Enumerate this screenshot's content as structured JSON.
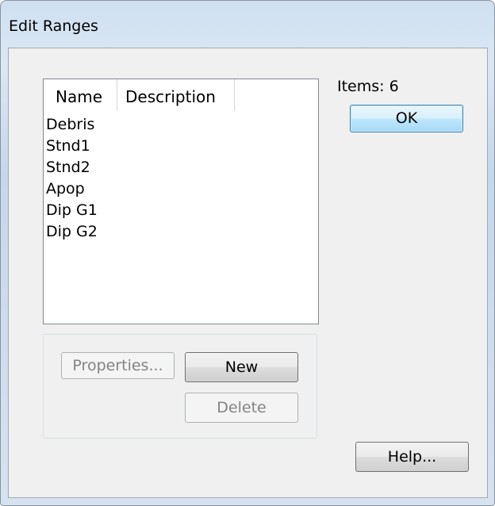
{
  "window": {
    "title": "Edit Ranges"
  },
  "list": {
    "columns": [
      "Name",
      "Description"
    ],
    "rows": [
      {
        "name": "Debris",
        "description": ""
      },
      {
        "name": "Stnd1",
        "description": ""
      },
      {
        "name": "Stnd2",
        "description": ""
      },
      {
        "name": "Apop",
        "description": ""
      },
      {
        "name": "Dip G1",
        "description": ""
      },
      {
        "name": "Dip G2",
        "description": ""
      }
    ]
  },
  "buttons": {
    "properties": {
      "label": "Properties...",
      "enabled": false
    },
    "new": {
      "label": "New",
      "enabled": true
    },
    "delete": {
      "label": "Delete",
      "enabled": false
    },
    "ok": {
      "label": "OK",
      "enabled": true,
      "default": true
    },
    "help": {
      "label": "Help...",
      "enabled": true
    }
  },
  "status": {
    "items_count": "Items: 6"
  },
  "colors": {
    "client_bg": "#f0f0f0",
    "default_button_accent": "#3c7fb1",
    "disabled_text": "#838383"
  }
}
